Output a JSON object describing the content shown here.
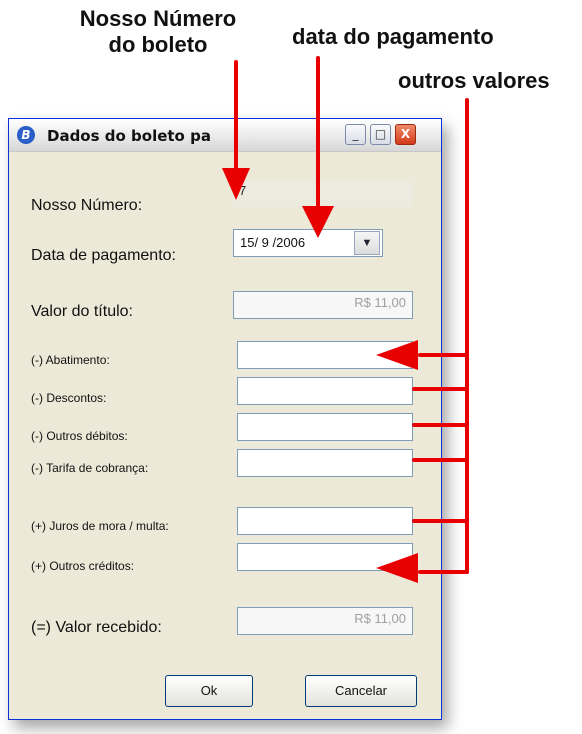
{
  "annotations": {
    "nosso_numero_line1": "Nosso Número",
    "nosso_numero_line2": "do boleto",
    "data_pagamento": "data do pagamento",
    "outros_valores": "outros valores"
  },
  "window": {
    "title": "Dados do boleto pa",
    "app_icon": "B",
    "buttons": {
      "minimize": "_",
      "maximize": "□",
      "close": "X"
    }
  },
  "form": {
    "nosso_numero": {
      "label": "Nosso Número:",
      "value": "7"
    },
    "data_pagamento": {
      "label": "Data de pagamento:",
      "value": "15/ 9 /2006"
    },
    "valor_titulo": {
      "label": "Valor do título:",
      "value": "R$ 11,00"
    },
    "abatimento": {
      "label": "(-) Abatimento:",
      "value": ""
    },
    "descontos": {
      "label": "(-) Descontos:",
      "value": ""
    },
    "outros_debitos": {
      "label": "(-) Outros débitos:",
      "value": ""
    },
    "tarifa_cobranca": {
      "label": "(-) Tarifa de cobrança:",
      "value": ""
    },
    "juros_mora": {
      "label": "(+) Juros de mora / multa:",
      "value": ""
    },
    "outros_creditos": {
      "label": "(+) Outros créditos:",
      "value": ""
    },
    "valor_recebido": {
      "label": "(=) Valor recebido:",
      "value": "R$ 11,00"
    }
  },
  "actions": {
    "ok": "Ok",
    "cancel": "Cancelar"
  },
  "colors": {
    "arrow": "#e80000",
    "window_bg": "#ece9d8",
    "field_border": "#7f9db9"
  }
}
